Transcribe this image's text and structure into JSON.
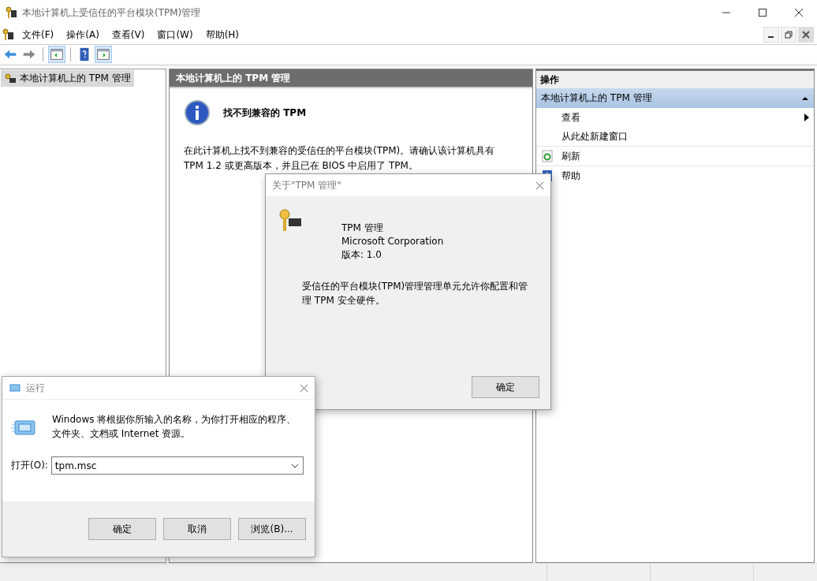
{
  "window": {
    "title": "本地计算机上受信任的平台模块(TPM)管理"
  },
  "menu": [
    "文件(F)",
    "操作(A)",
    "查看(V)",
    "窗口(W)",
    "帮助(H)"
  ],
  "toolbar": [
    {
      "kind": "back",
      "pressed": false
    },
    {
      "kind": "forward",
      "pressed": false
    },
    {
      "kind": "tree",
      "pressed": true
    },
    {
      "kind": "help",
      "pressed": false
    },
    {
      "kind": "actions",
      "pressed": true
    }
  ],
  "tree": {
    "items": [
      {
        "label": "本地计算机上的 TPM 管理",
        "selected": true
      }
    ]
  },
  "content": {
    "header": "本地计算机上的 TPM 管理",
    "heading": "找不到兼容的 TPM",
    "body": "在此计算机上找不到兼容的受信任的平台模块(TPM)。请确认该计算机具有 TPM 1.2 或更高版本，并且已在 BIOS 中启用了 TPM。"
  },
  "actions": {
    "title": "操作",
    "group": "本地计算机上的 TPM 管理",
    "expanded": true,
    "items": [
      {
        "label": "查看",
        "kind": "submenu"
      },
      {
        "label": "从此处新建窗口",
        "kind": "plain"
      },
      {
        "label": "刷新",
        "kind": "refresh"
      },
      {
        "label": "帮助",
        "kind": "help"
      }
    ]
  },
  "about_dialog": {
    "title": "关于\"TPM 管理\"",
    "product": "TPM 管理",
    "company": "Microsoft Corporation",
    "version": "版本: 1.0",
    "description": "受信任的平台模块(TPM)管理管理单元允许你配置和管理 TPM 安全硬件。",
    "ok": "确定"
  },
  "run_dialog": {
    "title": "运行",
    "text": "Windows 将根据你所输入的名称，为你打开相应的程序、文件夹、文档或 Internet 资源。",
    "open_label": "打开(O):",
    "value": "tpm.msc",
    "buttons": [
      "确定",
      "取消",
      "浏览(B)..."
    ]
  }
}
